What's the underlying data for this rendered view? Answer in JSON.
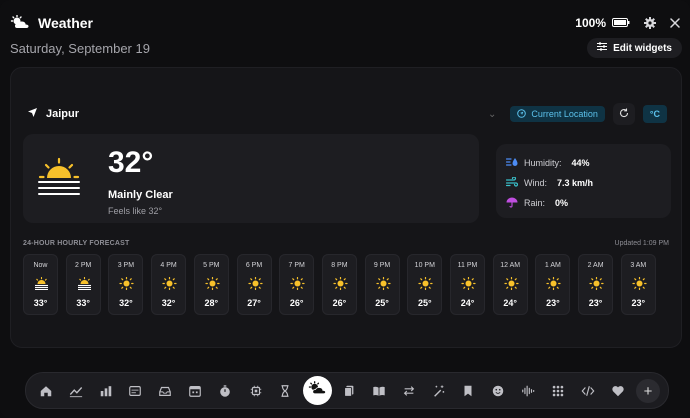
{
  "app": {
    "title": "Weather",
    "battery": "100%",
    "date": "Saturday, September 19",
    "edit_widgets": "Edit widgets"
  },
  "location": {
    "city": "Jaipur",
    "current_location": "Current Location",
    "unit": "°C"
  },
  "current": {
    "temp": "32°",
    "condition": "Mainly Clear",
    "feels_like": "Feels like 32°"
  },
  "details": {
    "humidity_label": "Humidity:",
    "humidity": "44%",
    "wind_label": "Wind:",
    "wind": "7.3 km/h",
    "rain_label": "Rain:",
    "rain": "0%"
  },
  "forecast": {
    "title": "24-HOUR HOURLY FORECAST",
    "updated": "Updated 1:09 PM",
    "hours": [
      {
        "time": "Now",
        "temp": "33°",
        "icon": "sun-haze-icon"
      },
      {
        "time": "2 PM",
        "temp": "33°",
        "icon": "sun-haze-icon"
      },
      {
        "time": "3 PM",
        "temp": "32°",
        "icon": "sun-icon"
      },
      {
        "time": "4 PM",
        "temp": "32°",
        "icon": "sun-icon"
      },
      {
        "time": "5 PM",
        "temp": "28°",
        "icon": "sun-icon"
      },
      {
        "time": "6 PM",
        "temp": "27°",
        "icon": "sun-icon"
      },
      {
        "time": "7 PM",
        "temp": "26°",
        "icon": "sun-icon"
      },
      {
        "time": "8 PM",
        "temp": "26°",
        "icon": "sun-icon"
      },
      {
        "time": "9 PM",
        "temp": "25°",
        "icon": "sun-icon"
      },
      {
        "time": "10 PM",
        "temp": "25°",
        "icon": "sun-icon"
      },
      {
        "time": "11 PM",
        "temp": "24°",
        "icon": "sun-icon"
      },
      {
        "time": "12 AM",
        "temp": "24°",
        "icon": "sun-icon"
      },
      {
        "time": "1 AM",
        "temp": "23°",
        "icon": "sun-icon"
      },
      {
        "time": "2 AM",
        "temp": "23°",
        "icon": "sun-icon"
      },
      {
        "time": "3 AM",
        "temp": "23°",
        "icon": "sun-icon"
      }
    ]
  },
  "dock": {
    "items": [
      "home-icon",
      "trend-icon",
      "bar-chart-icon",
      "card-icon",
      "inbox-icon",
      "calendar-icon",
      "timer-icon",
      "chip-icon",
      "hourglass-icon",
      "weather-icon",
      "files-icon",
      "book-icon",
      "transfer-icon",
      "magic-icon",
      "bookmark-icon",
      "smile-icon",
      "audio-icon",
      "grid-icon",
      "code-icon",
      "heart-icon"
    ],
    "add_label": "+"
  },
  "colors": {
    "accent": "#5cc2ec",
    "sun": "#f7c12b",
    "humidity": "#4d8df5",
    "wind": "#3ac0c9",
    "rain": "#c04ee0"
  }
}
